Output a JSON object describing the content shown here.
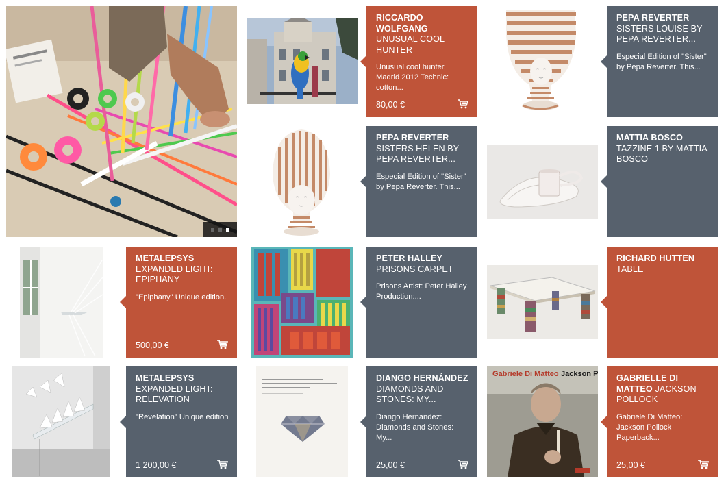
{
  "products": [
    {
      "artist": "RICCARDO WOLFGANG",
      "artwork": "UNUSUAL COOL HUNTER",
      "description": "Unusual cool hunter, Madrid 2012 Technic: cotton...",
      "price": "80,00 €"
    },
    {
      "artist": "PEPA REVERTER",
      "artwork": "SISTERS LOUISE BY PEPA REVERTER...",
      "description": "Especial Edition of \"Sister\" by Pepa Reverter. This..."
    },
    {
      "artist": "PEPA REVERTER",
      "artwork": "SISTERS HELEN BY PEPA REVERTER...",
      "description": "Especial Edition of \"Sister\" by Pepa Reverter. This..."
    },
    {
      "artist": "MATTIA BOSCO",
      "artwork": "TAZZINE 1 BY MATTIA BOSCO",
      "description": ""
    },
    {
      "artist": "METALEPSYS",
      "artwork": "EXPANDED LIGHT: EPIPHANY",
      "description": "\"Epiphany\" Unique edition.",
      "price": "500,00 €"
    },
    {
      "artist": "PETER HALLEY",
      "artwork": "PRISONS CARPET",
      "description": "Prisons Artist: Peter Halley Production:..."
    },
    {
      "artist": "RICHARD HUTTEN",
      "artwork": "TABLE",
      "description": ""
    },
    {
      "artist": "METALEPSYS",
      "artwork": "EXPANDED LIGHT: RELEVATION",
      "description": "\"Revelation\" Unique edition",
      "price": "1 200,00 €"
    },
    {
      "artist": "DIANGO HERNÁNDEZ",
      "artwork": "DIAMONDS AND STONES: MY...",
      "description": "Diango Hernandez: Diamonds and Stones: My...",
      "price": "25,00 €"
    },
    {
      "artist": "GABRIELLE DI MATTEO",
      "artwork": "JACKSON POLLOCK",
      "description": "Gabriele Di Matteo: Jackson Pollock Paperback...",
      "price": "25,00 €"
    }
  ],
  "book_cover": {
    "left_text": "Gabriele Di Matteo",
    "right_text": "Jackson Pollock"
  },
  "slider": {
    "count": 3,
    "active_index": 2
  },
  "icons": {
    "cart": "shopping-cart-icon"
  },
  "colors": {
    "orange": "#bf5439",
    "slate": "#57616d"
  }
}
